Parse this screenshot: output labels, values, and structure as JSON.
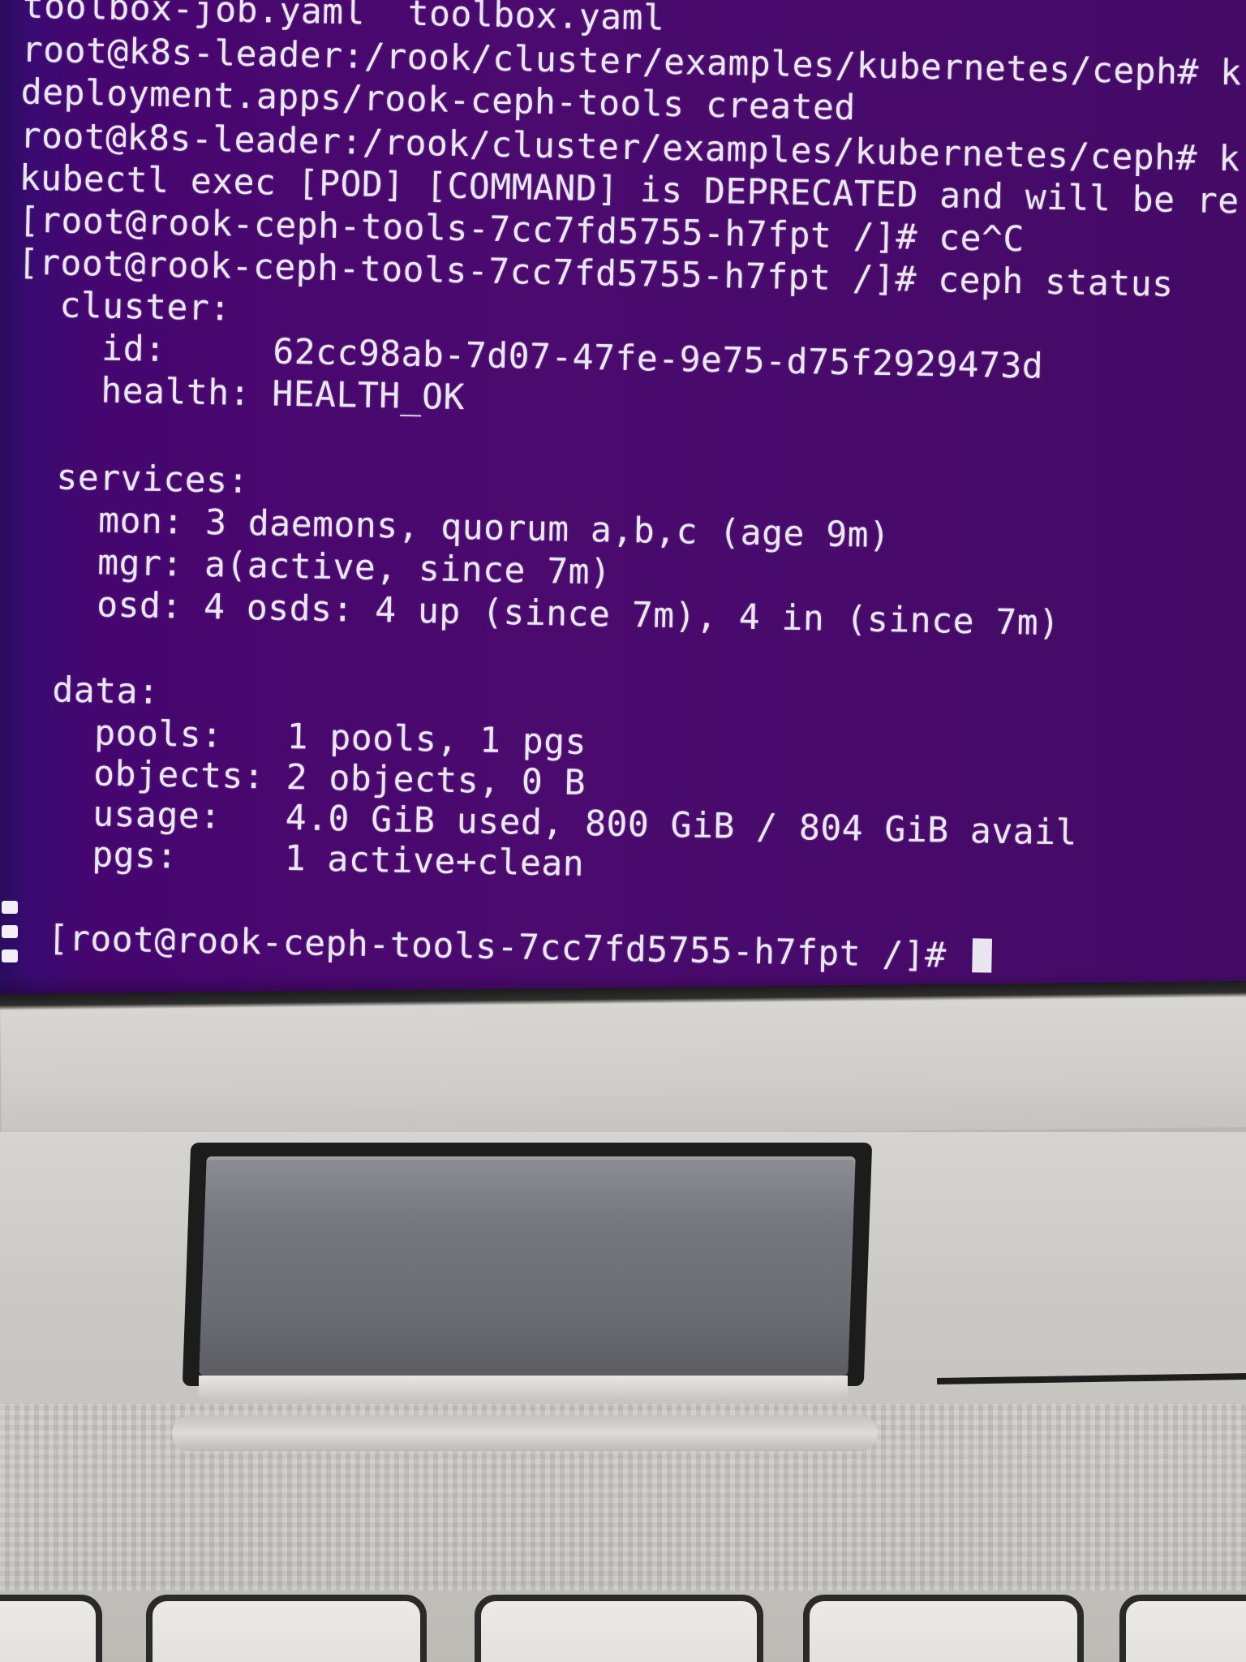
{
  "terminal": {
    "lines": [
      "toolbox-job.yaml  toolbox.yaml",
      "root@k8s-leader:/rook/cluster/examples/kubernetes/ceph# k",
      "deployment.apps/rook-ceph-tools created",
      "root@k8s-leader:/rook/cluster/examples/kubernetes/ceph# k",
      "kubectl exec [POD] [COMMAND] is DEPRECATED and will be re",
      "[root@rook-ceph-tools-7cc7fd5755-h7fpt /]# ce^C",
      "[root@rook-ceph-tools-7cc7fd5755-h7fpt /]# ceph status",
      "  cluster:",
      "    id:     62cc98ab-7d07-47fe-9e75-d75f2929473d",
      "    health: HEALTH_OK",
      "  services:",
      "    mon: 3 daemons, quorum a,b,c (age 9m)",
      "    mgr: a(active, since 7m)",
      "    osd: 4 osds: 4 up (since 7m), 4 in (since 7m)",
      "  data:",
      "    pools:   1 pools, 1 pgs",
      "    objects: 2 objects, 0 B",
      "    usage:   4.0 GiB used, 800 GiB / 804 GiB avail",
      "    pgs:     1 active+clean",
      "  [root@rook-ceph-tools-7cc7fd5755-h7fpt /]# "
    ]
  },
  "dock": {
    "icon": "app-grid-dots-icon"
  },
  "colors": {
    "terminal_bg": "#46066f",
    "terminal_fg": "#eae6f2",
    "laptop_body": "#cfcdc9",
    "hinge": "#76777e"
  }
}
